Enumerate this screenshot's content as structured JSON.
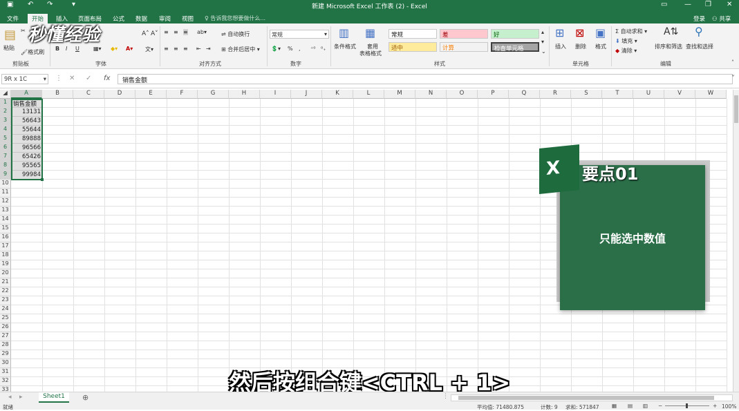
{
  "window": {
    "title": "新建 Microsoft Excel 工作表 (2) - Excel"
  },
  "tabs": [
    {
      "label": "文件"
    },
    {
      "label": "开始"
    },
    {
      "label": "插入"
    },
    {
      "label": "页面布局"
    },
    {
      "label": "公式"
    },
    {
      "label": "数据"
    },
    {
      "label": "审阅"
    },
    {
      "label": "视图"
    }
  ],
  "tell_me": "告诉我您想要做什么...",
  "account": {
    "login": "登录",
    "share": "共享"
  },
  "ribbon": {
    "clipboard": {
      "label": "剪贴板",
      "paste": "粘贴",
      "format_painter": "格式刷"
    },
    "font": {
      "label": "字体"
    },
    "alignment": {
      "label": "对齐方式",
      "wrap": "自动换行",
      "merge": "合并后居中"
    },
    "number": {
      "label": "数字",
      "format": "常规"
    },
    "styles": {
      "label": "样式",
      "conditional": "条件格式",
      "table": "套用\n表格格式",
      "table_l1": "套用",
      "table_l2": "表格格式",
      "normal": "常规",
      "bad": "差",
      "good": "好",
      "neutral": "适中",
      "calc": "计算",
      "check": "检查单元格"
    },
    "cells": {
      "label": "单元格",
      "insert": "插入",
      "delete": "删除",
      "format": "格式"
    },
    "editing": {
      "label": "编辑",
      "autosum": "自动求和",
      "fill": "填充",
      "clear": "清除",
      "sort": "排序和筛选",
      "find": "查找和选择"
    }
  },
  "formula_bar": {
    "name_box": "9R x 1C",
    "value": "销售金额"
  },
  "columns": [
    "A",
    "B",
    "C",
    "D",
    "E",
    "F",
    "G",
    "H",
    "I",
    "J",
    "K",
    "L",
    "M",
    "N",
    "O",
    "P",
    "Q",
    "R",
    "S",
    "T",
    "U",
    "V",
    "W"
  ],
  "rows": [
    "1",
    "2",
    "3",
    "4",
    "5",
    "6",
    "7",
    "8",
    "9",
    "10",
    "11",
    "12",
    "13",
    "14",
    "15",
    "16",
    "17",
    "18",
    "19",
    "20",
    "21",
    "22",
    "23",
    "24",
    "25",
    "26",
    "27",
    "28",
    "29",
    "30",
    "31",
    "32",
    "33"
  ],
  "cells": {
    "header": "销售金额",
    "values": [
      "13131",
      "56643",
      "55644",
      "89888",
      "96566",
      "65426",
      "95565",
      "99984"
    ]
  },
  "sheet": {
    "name": "Sheet1"
  },
  "status": {
    "ready": "就绪",
    "average": "平均值: 71480.875",
    "count": "计数: 9",
    "sum": "求和: 571847",
    "zoom": "100%"
  },
  "overlay": {
    "keypoint": "要点01",
    "tip": "只能选中数值",
    "logo": "X"
  },
  "subtitle": "然后按组合键<CTRL + 1>",
  "watermark": "秒懂经验",
  "colors": {
    "excel_green": "#217346",
    "card_green": "#2b6f49"
  }
}
